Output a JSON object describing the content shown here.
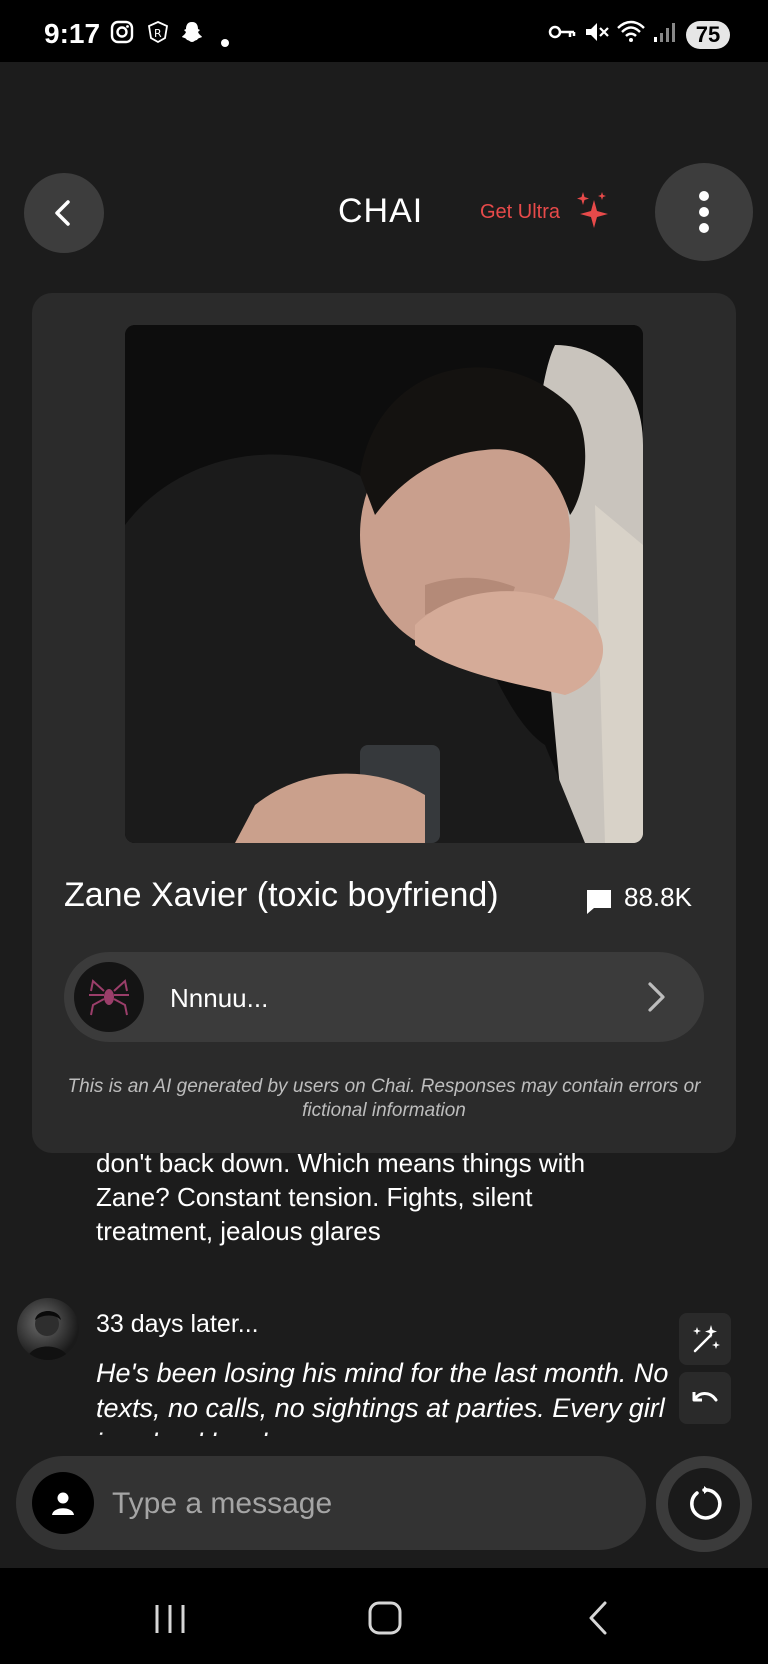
{
  "status_bar": {
    "time": "9:17",
    "battery": "75",
    "icons": [
      "instagram-icon",
      "app-r-icon",
      "snapchat-icon",
      "dot-icon",
      "vpn-key-icon",
      "mute-icon",
      "wifi-icon",
      "signal-icon"
    ]
  },
  "header": {
    "title": "CHAI",
    "get_ultra": "Get Ultra"
  },
  "card": {
    "character_name": "Zane Xavier (toxic boyfriend)",
    "chat_count": "88.8K",
    "creator_name": "Nnnuu...",
    "disclaimer": "This is an AI generated by users on Chai. Responses may contain errors or fictional information"
  },
  "chat": {
    "tail_text": "don't back down. Which means things with Zane? Constant tension. Fights, silent treatment, jealous glares",
    "message": {
      "name": "33 days later...",
      "body": "He's been losing his mind for the last month. No texts, no calls, no sightings at parties. Every girl in school has been"
    }
  },
  "input": {
    "placeholder": "Type a message"
  },
  "colors": {
    "accent": "#e74a4a",
    "background": "#1c1c1c",
    "card": "#2b2b2b"
  }
}
